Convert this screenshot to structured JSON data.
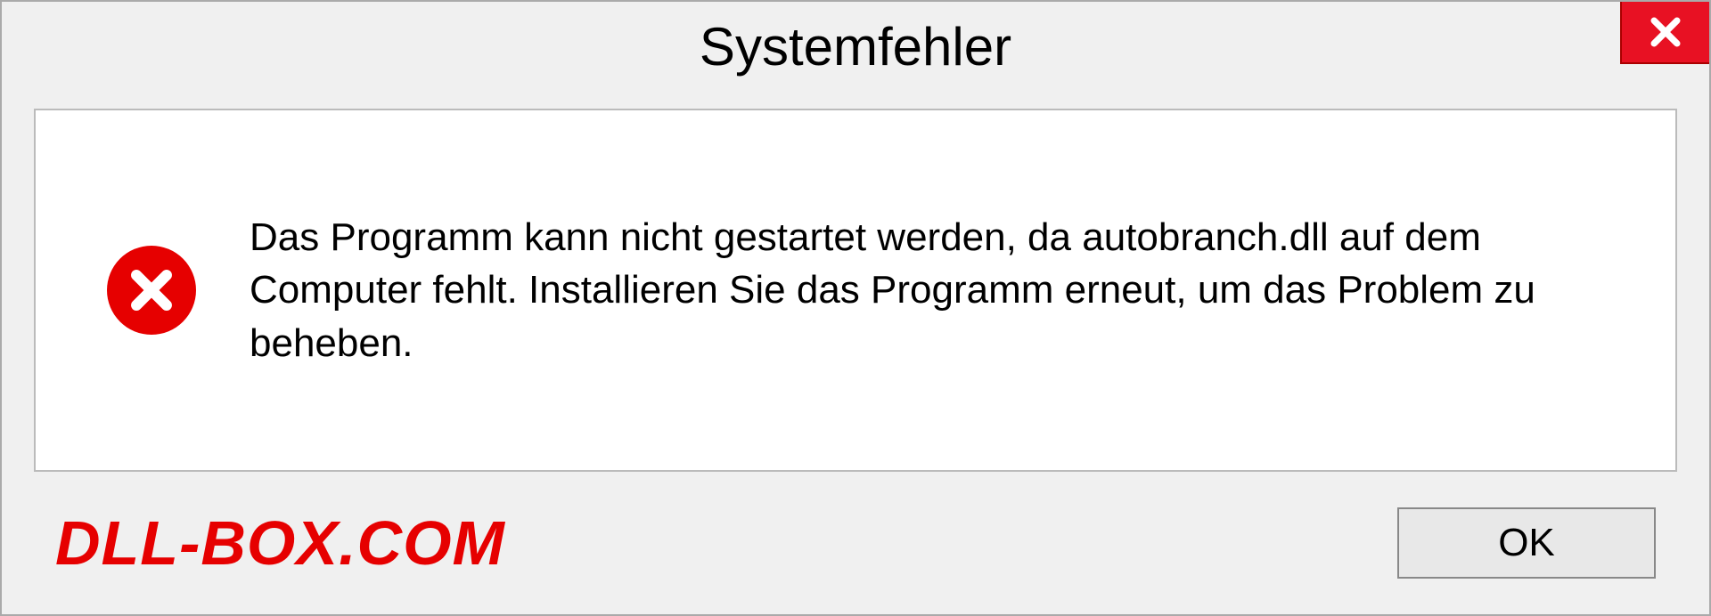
{
  "dialog": {
    "title": "Systemfehler",
    "message": "Das Programm kann nicht gestartet werden, da autobranch.dll auf dem Computer fehlt. Installieren Sie das Programm erneut, um das Problem zu beheben.",
    "ok_label": "OK"
  },
  "watermark": "DLL-BOX.COM"
}
